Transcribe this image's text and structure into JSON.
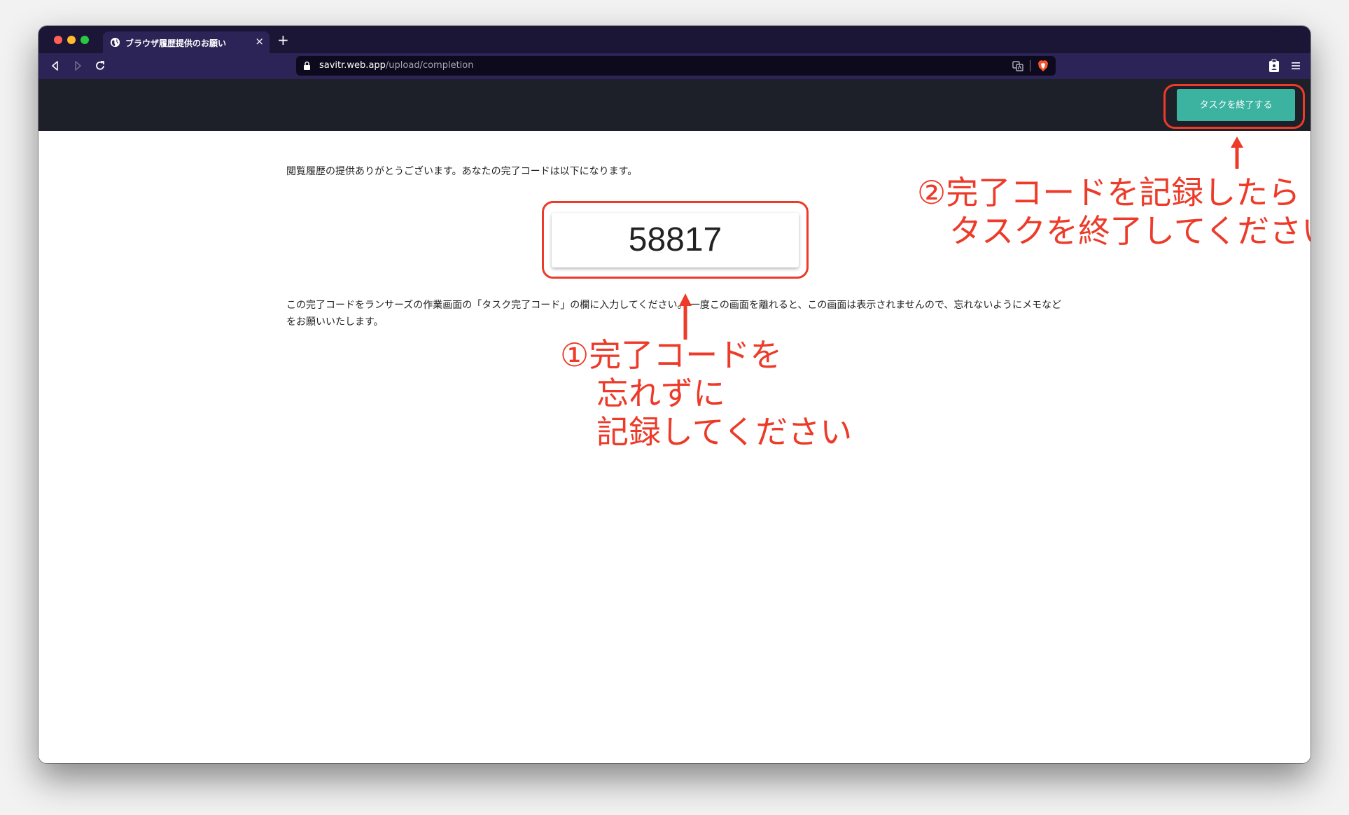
{
  "browser": {
    "tab_title": "ブラウザ履歴提供のお願い",
    "tab_close": "×",
    "new_tab": "+",
    "url_host": "savitr.web.app",
    "url_path": "/upload/completion"
  },
  "header": {
    "finish_button": "タスクを終了する"
  },
  "content": {
    "thanks_text": "閲覧履歴の提供ありがとうございます。あなたの完了コードは以下になります。",
    "completion_code": "58817",
    "instruction_text": "この完了コードをランサーズの作業画面の「タスク完了コード」の欄に入力してください。 一度この画面を離れると、この画面は表示されませんので、忘れないようにメモなどをお願いいたします。"
  },
  "annotations": {
    "note_1": [
      "①完了コードを",
      "忘れずに",
      "記録してください"
    ],
    "note_2": [
      "②完了コードを記録したら",
      "タスクを終了してください"
    ],
    "accent_color": "#ed3a29"
  },
  "colors": {
    "tab_strip": "#1b1635",
    "toolbar": "#2c2456",
    "app_header": "#1e2029",
    "finish_button": "#3bb3a0"
  }
}
